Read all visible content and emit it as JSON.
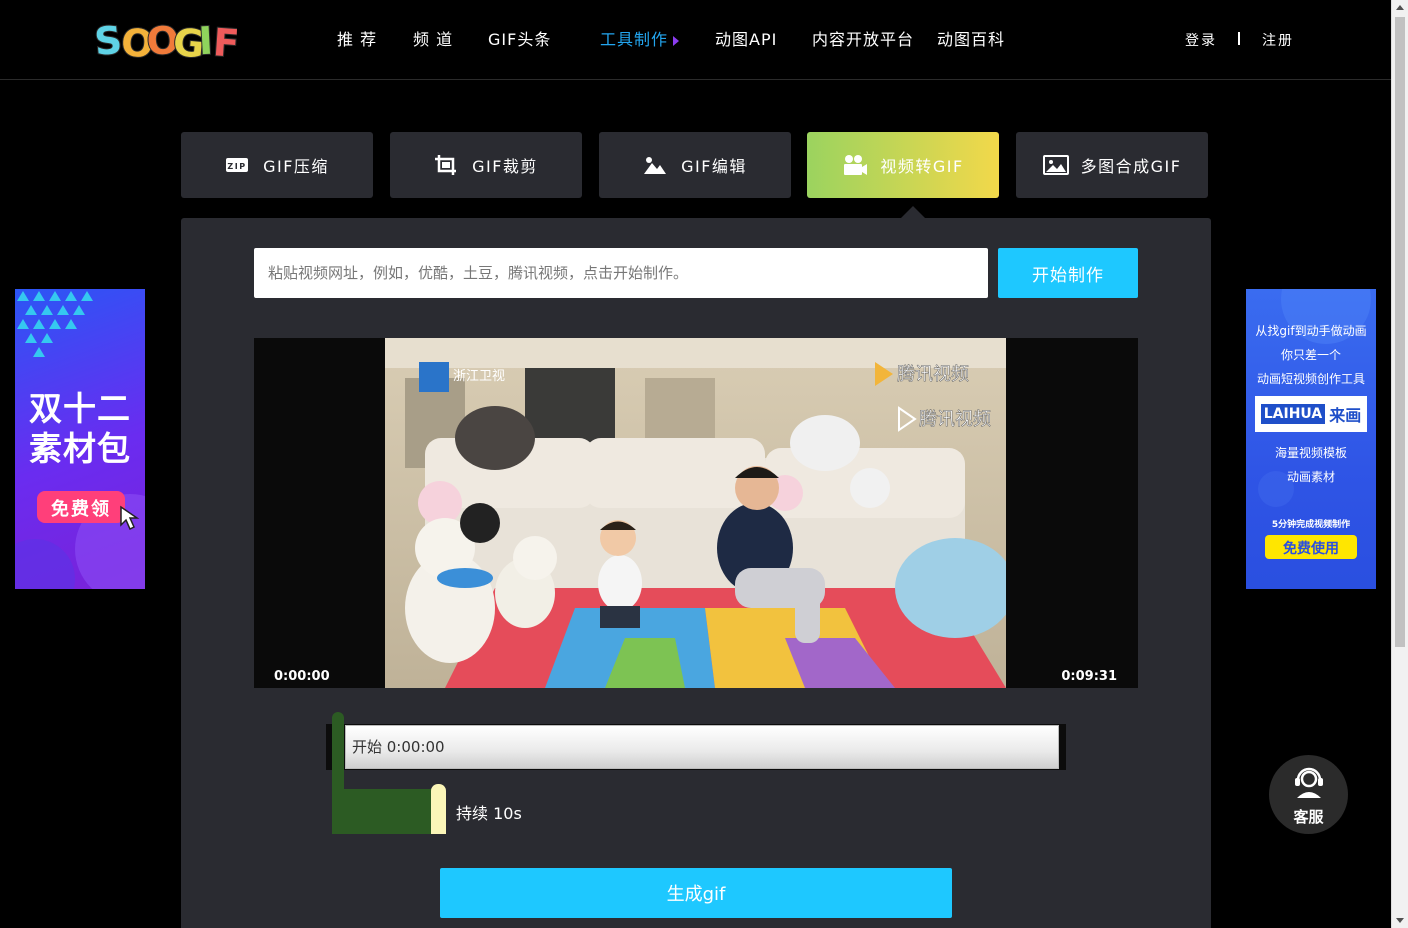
{
  "header": {
    "logo_text": "SOOGIF",
    "nav": [
      "推 荐",
      "频 道",
      "GIF头条",
      "工具制作",
      "动图API",
      "内容开放平台",
      "动图百科"
    ],
    "active_nav": "工具制作",
    "login": "登录",
    "register": "注册"
  },
  "tools": [
    {
      "label": "GIF压缩",
      "icon": "zip-icon"
    },
    {
      "label": "GIF裁剪",
      "icon": "crop-icon"
    },
    {
      "label": "GIF编辑",
      "icon": "image-edit-icon"
    },
    {
      "label": "视频转GIF",
      "icon": "video-camera-icon",
      "active": true
    },
    {
      "label": "多图合成GIF",
      "icon": "multi-image-icon"
    }
  ],
  "url_input": {
    "placeholder": "粘贴视频网址，例如，优酷，土豆，腾讯视频，点击开始制作。",
    "value": ""
  },
  "start_button": "开始制作",
  "video": {
    "start_time": "0:00:00",
    "end_time": "0:09:31",
    "watermark_channel": "浙江卫视",
    "watermark_1": "腾讯视频",
    "watermark_2": "腾讯视频"
  },
  "timeline": {
    "start_label": "开始 0:00:00",
    "duration_label": "持续 10s"
  },
  "generate_button": "生成gif",
  "ad_left": {
    "line1": "双十二",
    "line2": "素材包",
    "cta": "免费领"
  },
  "ad_right": {
    "line1": "从找gif到动手做动画",
    "line2": "你只差一个",
    "line3": "动画短视频创作工具",
    "brand_en": "LAIHUA",
    "brand_cn": "来画",
    "feature1": "海量视频模板",
    "feature2": "动画素材",
    "tagline": "5分钟完成视频制作",
    "cta": "免费使用"
  },
  "customer_service": "客服",
  "colors": {
    "accent_blue": "#1ec8ff",
    "active_nav": "#23a6f0",
    "panel_bg": "#2a2b31",
    "active_tab_from": "#9bd35f",
    "active_tab_to": "#f2d84a"
  }
}
